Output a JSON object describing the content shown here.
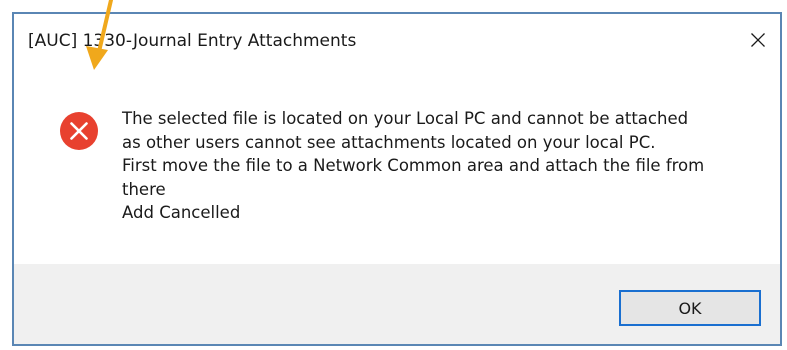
{
  "window": {
    "title": "[AUC] 1330-Journal Entry Attachments",
    "close_glyph": "✕"
  },
  "message": {
    "icon": "error-icon",
    "lines": [
      "The selected file is located on your Local PC and cannot be attached",
      "as other users cannot see attachments located on your local PC.",
      "First move the file to a Network Common area and attach the file from",
      "there",
      "Add Cancelled"
    ]
  },
  "buttons": {
    "ok_label": "OK"
  },
  "colors": {
    "error_red": "#e8412f",
    "border_blue": "#5a86b4",
    "focus_blue": "#1a6fd0",
    "annotation_arrow": "#f0a81c"
  }
}
